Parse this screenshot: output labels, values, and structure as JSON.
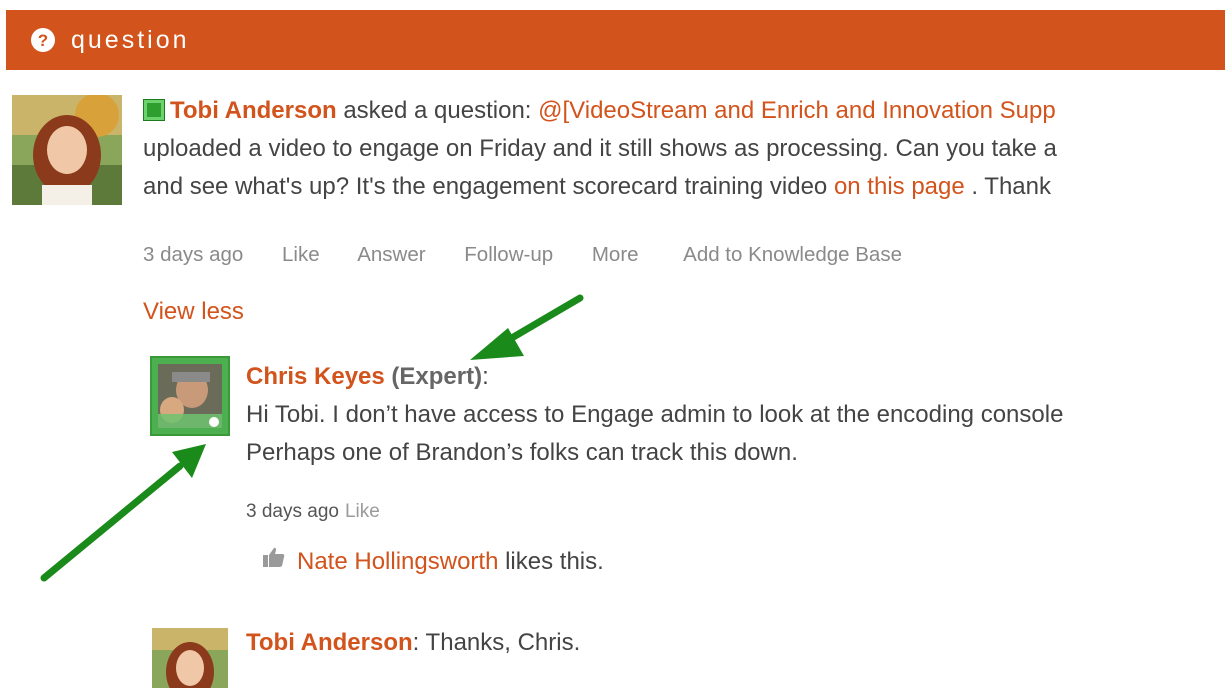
{
  "header": {
    "title": "question",
    "icon": "question-circle-icon"
  },
  "question": {
    "author": "Tobi Anderson",
    "verb": " asked a question: ",
    "mention": "@[VideoStream and Enrich and Innovation Supp",
    "line2": "uploaded a video to engage on Friday and it still shows as processing. Can you take a",
    "line3_pre": "and see what's up? It's the engagement scorecard training video ",
    "link": "on this page",
    "line3_post": " . Thank",
    "actions": [
      "3 days ago",
      "Like",
      "Answer",
      "Follow-up",
      "More",
      "Add to Knowledge Base"
    ]
  },
  "view_less": "View less",
  "reply1": {
    "author": "Chris Keyes",
    "badge": " (Expert)",
    "colon": ":",
    "line1": "Hi Tobi.  I don’t have access to Engage admin to look at the encoding console",
    "line2": "Perhaps one of Brandon’s folks can track this down.",
    "time": "3 days ago",
    "like": "Like",
    "liker": "Nate Hollingsworth",
    "likes_text": " likes this."
  },
  "reply2": {
    "author": "Tobi Anderson",
    "text": ": Thanks, Chris."
  },
  "colors": {
    "accent": "#d2531b",
    "annotation_arrow": "#1a8a1a",
    "expert_frame": "#4caf50"
  }
}
